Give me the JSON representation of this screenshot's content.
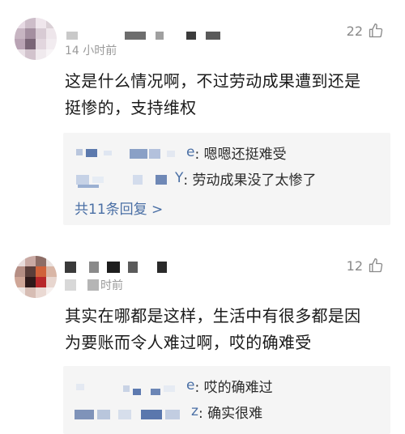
{
  "comments": [
    {
      "time": "14 小时前",
      "likes": "22",
      "text_line1": "这是什么情况啊，不过劳动成果遭到还是",
      "text_line2": "挺惨的，支持维权",
      "replies": [
        {
          "name_tail": "e",
          "text": ": 嗯嗯还挺难受"
        },
        {
          "name_tail": "Y",
          "text": ": 劳动成果没了太惨了"
        }
      ],
      "more": "共11条回复 >"
    },
    {
      "time": "时前",
      "likes": "12",
      "text_line1": "其实在哪都是这样，生活中有很多都是因",
      "text_line2": "为要账而令人难过啊，哎的确难受",
      "replies": [
        {
          "name_tail": "e",
          "text": ": 哎的确难过"
        },
        {
          "name_tail": "z",
          "text": ": 确实很难"
        }
      ]
    }
  ],
  "colors": {
    "reply_bg": "#f5f5f5",
    "link": "#4a6fa5",
    "meta": "#9a9a9a"
  },
  "icons": [
    "thumb-up-icon"
  ]
}
